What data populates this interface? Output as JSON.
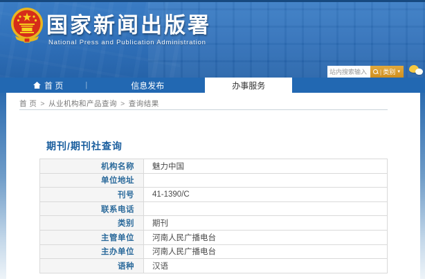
{
  "header": {
    "title": "国家新闻出版署",
    "subtitle": "National  Press  and  Publication  Administration",
    "search": {
      "placeholder": "站内搜索输入",
      "category_label": "类别"
    }
  },
  "nav": {
    "items": [
      {
        "label": "首 页"
      },
      {
        "label": "信息发布"
      },
      {
        "label": "办事服务",
        "active": true
      }
    ]
  },
  "breadcrumb": {
    "separator": ">",
    "items": [
      "首 页",
      "从业机构和产品查询",
      "查询结果"
    ]
  },
  "page": {
    "section_title": "期刊/期刊社查询",
    "table": {
      "rows": [
        {
          "label": "机构名称",
          "value": "魅力中国"
        },
        {
          "label": "单位地址",
          "value": ""
        },
        {
          "label": "刊号",
          "value": "41-1390/C"
        },
        {
          "label": "联系电话",
          "value": ""
        },
        {
          "label": "类别",
          "value": "期刊"
        },
        {
          "label": "主管单位",
          "value": "河南人民广播电台"
        },
        {
          "label": "主办单位",
          "value": "河南人民广播电台"
        },
        {
          "label": "语种",
          "value": "汉语"
        }
      ]
    }
  },
  "colors": {
    "header_blue": "#2f6fb8",
    "nav_blue": "#2268b2",
    "accent_gold": "#d9992b",
    "title_blue": "#1a5e9e",
    "label_blue": "#2b6a9b"
  }
}
